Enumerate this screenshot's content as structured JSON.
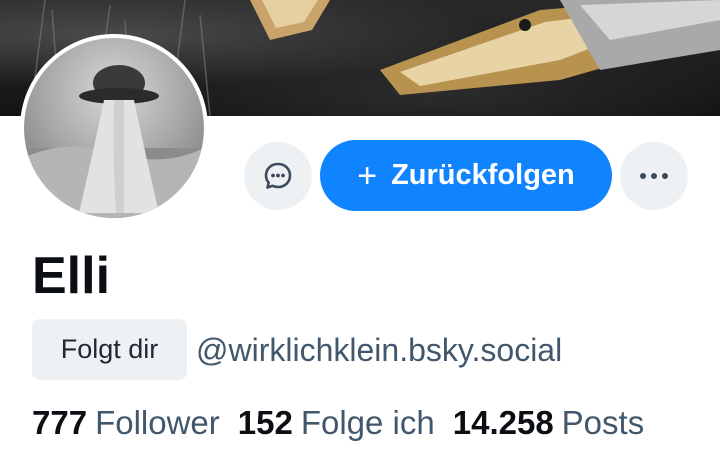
{
  "profile": {
    "display_name": "Elli",
    "follows_you_badge": "Folgt dir",
    "handle": "@wirklichklein.bsky.social"
  },
  "actions": {
    "message_icon": "chat-bubble-icon",
    "follow_back_icon": "plus-icon",
    "follow_back_label": "Zurückfolgen",
    "more_icon": "ellipsis-icon"
  },
  "stats": {
    "followers_count": "777",
    "followers_label": "Follower",
    "following_count": "152",
    "following_label": "Folge ich",
    "posts_count": "14.258",
    "posts_label": "Posts"
  },
  "colors": {
    "accent": "#1083fe",
    "button_bg": "#eef1f4",
    "text_primary": "#0b0f14",
    "text_secondary": "#42576c"
  }
}
